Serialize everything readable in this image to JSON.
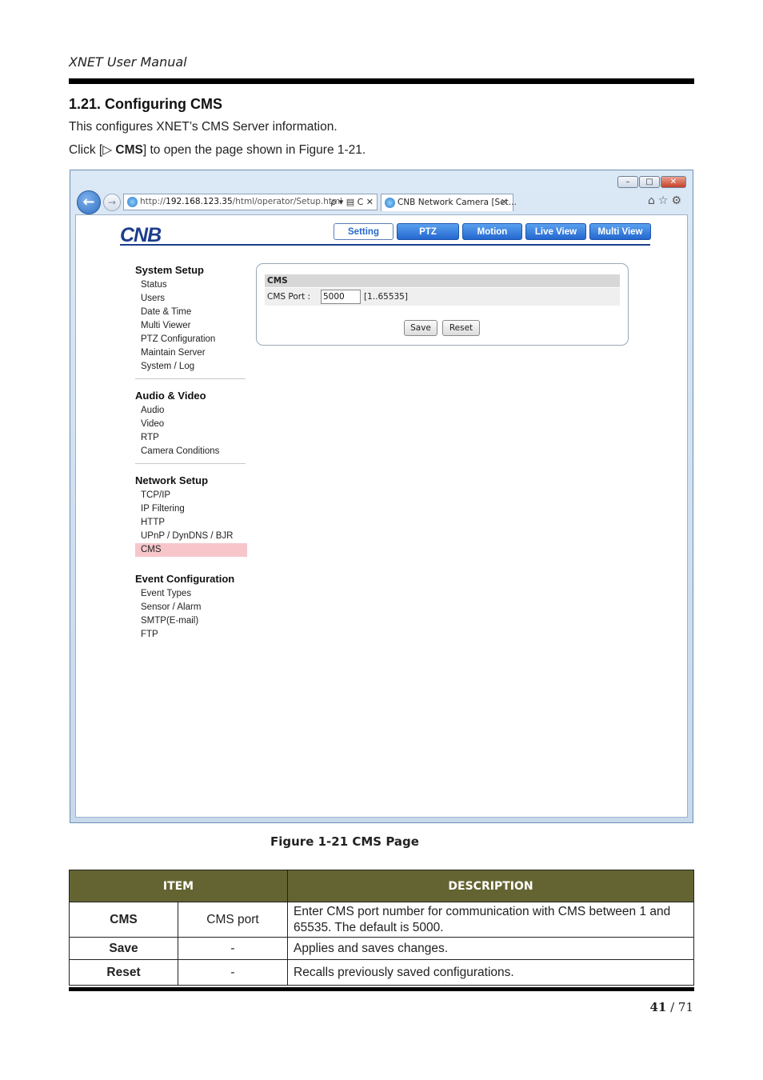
{
  "header": {
    "text": "XNET User Manual"
  },
  "section": {
    "title": "1.21. Configuring CMS"
  },
  "paragraphs": {
    "p1": "This configures XNET’s CMS Server information.",
    "p2_pre": "Click [▷ ",
    "p2_bold": "CMS",
    "p2_post": "] to open the page shown in Figure 1-21."
  },
  "browser": {
    "address_prefix": "http://",
    "address_host": "192.168.123.35",
    "address_path": "/html/operator/Setup.html",
    "address_tools": "ρ ▾ ▤ C ✕",
    "tab_title": "CNB Network Camera [Set...",
    "tab_close": "✕",
    "right_icons": "⌂☆⚙",
    "window_buttons": {
      "minimize": "–",
      "maximize": "□",
      "close": "✕"
    },
    "back": "←",
    "forward": "→"
  },
  "app": {
    "logo": "CNB",
    "tabs": [
      "Setting",
      "PTZ",
      "Motion",
      "Live View",
      "Multi View"
    ],
    "menu": {
      "system": {
        "title": "System Setup",
        "items": [
          "Status",
          "Users",
          "Date & Time",
          "Multi Viewer",
          "PTZ Configuration",
          "Maintain Server",
          "System / Log"
        ]
      },
      "av": {
        "title": "Audio & Video",
        "items": [
          "Audio",
          "Video",
          "RTP",
          "Camera Conditions"
        ]
      },
      "network": {
        "title": "Network Setup",
        "items": [
          "TCP/IP",
          "IP Filtering",
          "HTTP",
          "UPnP / DynDNS / BJR",
          "CMS"
        ]
      },
      "event": {
        "title": "Event Configuration",
        "items": [
          "Event Types",
          "Sensor / Alarm",
          "SMTP(E-mail)",
          "FTP"
        ]
      }
    },
    "cms_panel": {
      "heading": "CMS",
      "port_label": "CMS Port :",
      "port_value": "5000",
      "range": "[1..65535]",
      "save": "Save",
      "reset": "Reset"
    }
  },
  "figure_caption": "Figure 1-21 CMS Page",
  "table": {
    "headers": [
      "ITEM",
      "DESCRIPTION"
    ],
    "rows": [
      {
        "item": "CMS",
        "sub": "CMS port",
        "desc": "Enter CMS port number for communication with CMS between 1 and 65535. The default is 5000."
      },
      {
        "item": "Save",
        "sub": "-",
        "desc": "Applies and saves changes."
      },
      {
        "item": "Reset",
        "sub": "-",
        "desc": "Recalls previously saved configurations."
      }
    ]
  },
  "page": {
    "current": "41",
    "sep": " / ",
    "total": "71"
  }
}
